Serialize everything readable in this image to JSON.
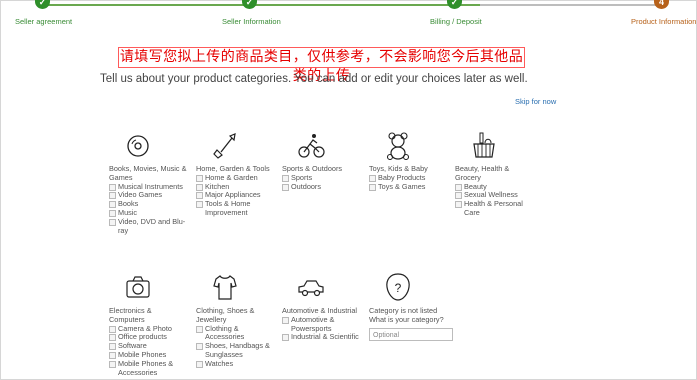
{
  "progress": {
    "steps": [
      {
        "label": "Seller agreement",
        "marker": "✓"
      },
      {
        "label": "Seller Information",
        "marker": "✓"
      },
      {
        "label": "Billing / Deposit",
        "marker": "✓"
      },
      {
        "label": "Product Information",
        "marker": "4"
      }
    ],
    "colors": {
      "done": "#2f8f2a",
      "current": "#b7621b"
    }
  },
  "banner": "请填写您拟上传的商品类目，仅供参考，不会影响您今后其他品类的上传",
  "intro": "Tell us about your product categories. You can add or edit your choices later as well.",
  "skip": "Skip for now",
  "categories": [
    {
      "icon": "cd-icon",
      "title": "Books, Movies, Music & Games",
      "items": [
        "Musical Instruments",
        "Video Games",
        "Books",
        "Music",
        "Video, DVD and Blu-ray"
      ]
    },
    {
      "icon": "shovel-icon",
      "title": "Home, Garden & Tools",
      "items": [
        "Home & Garden",
        "Kitchen",
        "Major Appliances",
        "Tools & Home Improvement"
      ]
    },
    {
      "icon": "cyclist-icon",
      "title": "Sports & Outdoors",
      "items": [
        "Sports",
        "Outdoors"
      ]
    },
    {
      "icon": "teddy-bear-icon",
      "title": "Toys, Kids & Baby",
      "items": [
        "Baby Products",
        "Toys & Games"
      ]
    },
    {
      "icon": "basket-icon",
      "title": "Beauty, Health & Grocery",
      "items": [
        "Beauty",
        "Sexual Wellness",
        "Health & Personal Care"
      ]
    },
    {
      "icon": "camera-icon",
      "title": "Electronics & Computers",
      "items": [
        "Camera & Photo",
        "Office products",
        "Software",
        "Mobile Phones",
        "Mobile Phones & Accessories"
      ]
    },
    {
      "icon": "shirt-icon",
      "title": "Clothing, Shoes & Jewellery",
      "items": [
        "Clothing & Accessories",
        "Shoes, Handbags & Sunglasses",
        "Watches"
      ]
    },
    {
      "icon": "car-icon",
      "title": "Automotive & Industrial",
      "items": [
        "Automotive & Powersports",
        "Industrial & Scientific"
      ]
    }
  ],
  "other": {
    "icon": "question-icon",
    "title": "Category is not listed",
    "question": "What is your category?",
    "placeholder": "Optional"
  }
}
